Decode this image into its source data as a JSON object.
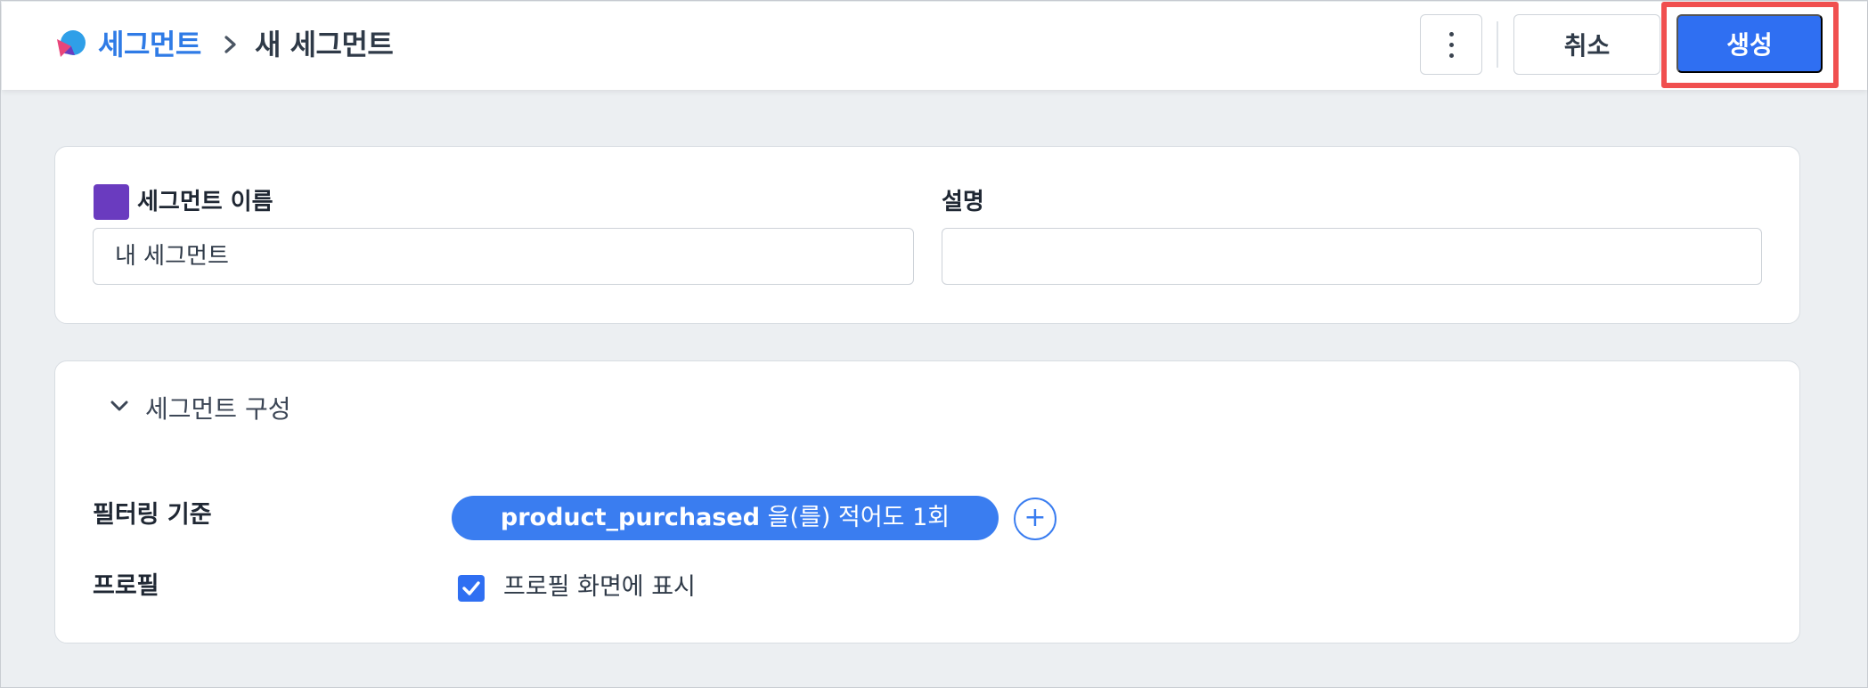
{
  "header": {
    "breadcrumb_root": "세그먼트",
    "breadcrumb_separator_icon": "chevron-right-icon",
    "breadcrumb_current": "새 세그먼트",
    "more_icon": "vertical-ellipsis-icon",
    "cancel_label": "취소",
    "create_label": "생성"
  },
  "details": {
    "name_label": "세그먼트 이름",
    "name_value": "내 세그먼트",
    "description_label": "설명",
    "description_value": "",
    "swatch_color": "#6a3bbf"
  },
  "composition": {
    "section_title": "세그먼트 구성",
    "filter_label": "필터링 기준",
    "filter_event": "product_purchased",
    "filter_condition": "을(를) 적어도 1회",
    "add_filter_icon": "plus-icon",
    "profile_label": "프로필",
    "profile_checkbox_label": "프로필 화면에 표시",
    "profile_checked": true
  },
  "colors": {
    "accent": "#2f6ff2",
    "highlight": "#f04f4f",
    "breadcrumb": "#2f7be6"
  }
}
